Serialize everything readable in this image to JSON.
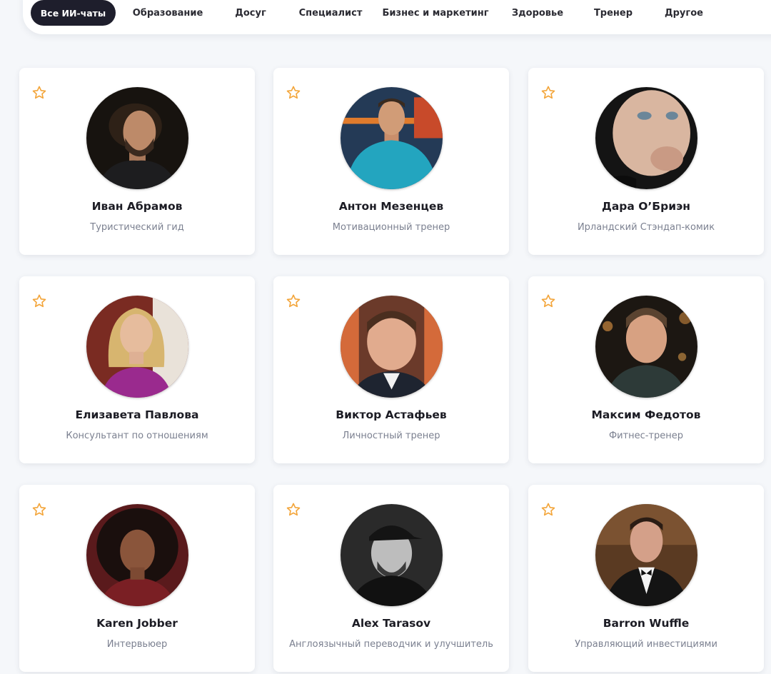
{
  "tabs": [
    {
      "label": "Все ИИ-чаты",
      "active": true
    },
    {
      "label": "Образование",
      "active": false
    },
    {
      "label": "Досуг",
      "active": false
    },
    {
      "label": "Специалист",
      "active": false
    },
    {
      "label": "Бизнес и маркетинг",
      "active": false
    },
    {
      "label": "Здоровье",
      "active": false
    },
    {
      "label": "Тренер",
      "active": false
    },
    {
      "label": "Другое",
      "active": false
    }
  ],
  "colors": {
    "accent_star": "#f3a53a",
    "active_tab_bg": "#1e1e2c",
    "page_bg": "#f5f7fa",
    "name_text": "#1c1c24",
    "role_text": "#7b8090"
  },
  "star_icon": "star-outline-icon",
  "cards": [
    {
      "name": "Иван Абрамов",
      "role": "Туристический гид"
    },
    {
      "name": "Антон Мезенцев",
      "role": "Мотивационный тренер"
    },
    {
      "name": "Дара О’Бриэн",
      "role": "Ирландский Стэндап-комик"
    },
    {
      "name": "Елизавета Павлова",
      "role": "Консультант по отношениям"
    },
    {
      "name": "Виктор Астафьев",
      "role": "Личностный тренер"
    },
    {
      "name": "Максим Федотов",
      "role": "Фитнес-тренер"
    },
    {
      "name": "Karen Jobber",
      "role": "Интервьюер"
    },
    {
      "name": "Alex Tarasov",
      "role": "Англоязычный переводчик и улучшитель"
    },
    {
      "name": "Barron Wuffle",
      "role": "Управляющий инвестициями"
    }
  ]
}
